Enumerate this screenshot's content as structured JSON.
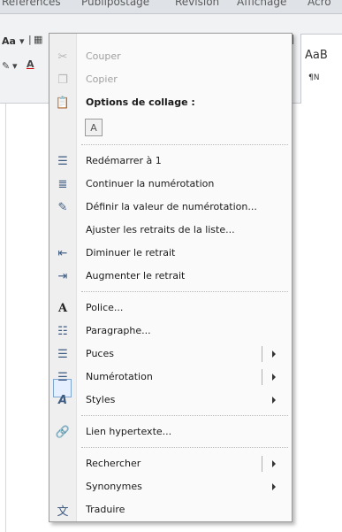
{
  "ribbon": {
    "tabs": [
      "Références",
      "Publipostage",
      "Révision",
      "Affichage",
      "Acro"
    ],
    "font_size_label": "Aa",
    "styles_label": "AaB",
    "styles_sub_label": "¶N"
  },
  "menu": {
    "items": [
      {
        "label": "Couper",
        "icon": "scissors-icon",
        "disabled": true
      },
      {
        "label": "Copier",
        "icon": "copy-icon",
        "disabled": true
      },
      {
        "label": "Options de collage :",
        "icon": "clipboard-icon",
        "header": true
      },
      {
        "label": "Redémarrer à 1",
        "icon": "numbered-list-icon"
      },
      {
        "label": "Continuer la numérotation",
        "icon": "continue-numbering-icon"
      },
      {
        "label": "Définir la valeur de numérotation...",
        "icon": "set-value-icon"
      },
      {
        "label": "Ajuster les retraits de la liste...",
        "icon": ""
      },
      {
        "label": "Diminuer le retrait",
        "icon": "decrease-indent-icon"
      },
      {
        "label": "Augmenter le retrait",
        "icon": "increase-indent-icon"
      },
      {
        "label": "Police...",
        "icon": "font-icon"
      },
      {
        "label": "Paragraphe...",
        "icon": "paragraph-icon"
      },
      {
        "label": "Puces",
        "icon": "bullets-icon",
        "submenu": true
      },
      {
        "label": "Numérotation",
        "icon": "numbering-icon",
        "submenu": true
      },
      {
        "label": "Styles",
        "icon": "styles-icon",
        "submenu": true
      },
      {
        "label": "Lien hypertexte...",
        "icon": "hyperlink-icon"
      },
      {
        "label": "Rechercher",
        "icon": "",
        "submenu": true
      },
      {
        "label": "Synonymes",
        "icon": "",
        "submenu": true
      },
      {
        "label": "Traduire",
        "icon": "translate-icon"
      }
    ]
  }
}
